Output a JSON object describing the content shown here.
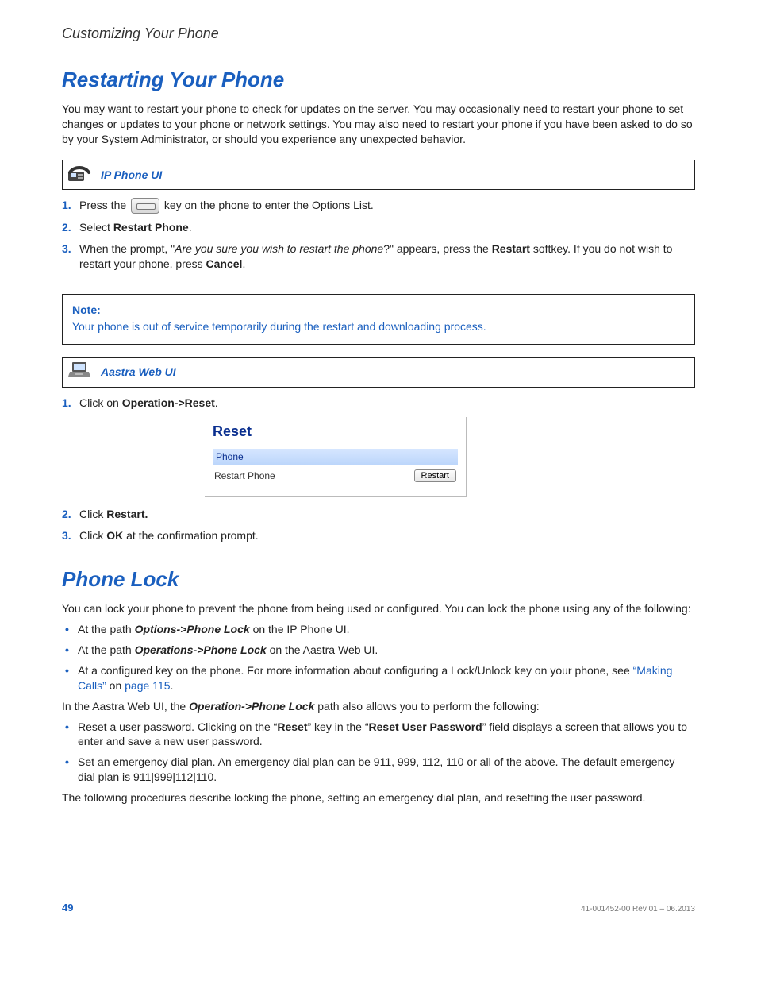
{
  "runningHead": "Customizing Your Phone",
  "sections": {
    "restart": {
      "title": "Restarting Your Phone",
      "intro": "You may want to restart your phone to check for updates on the server. You may occasionally need to restart your phone to set changes or updates to your phone or network settings.   You may also need to restart your phone if you have been asked to do so by your System Administrator, or should you experience any unexpected behavior."
    },
    "lock": {
      "title": "Phone Lock",
      "intro": "You can lock your phone to prevent the phone from being used or configured. You can lock the phone using any of the following:",
      "mid": "path also allows you to perform the following:",
      "midPathLabel": "Operation->Phone Lock",
      "midPrefix": "In the Aastra Web UI, the ",
      "closing": "The following procedures describe locking the phone, setting an emergency dial plan, and resetting the user password."
    }
  },
  "callouts": {
    "ipPhone": "IP Phone UI",
    "webUi": "Aastra Web UI"
  },
  "ipSteps": {
    "s1a": "Press the ",
    "s1b": " key on the phone to enter the Options List.",
    "s2a": "Select ",
    "s2b": "Restart Phone",
    "s2c": ".",
    "s3a": "When the prompt, \"",
    "s3b": "Are you sure you wish to restart the phone",
    "s3c": "?\" appears, press the ",
    "s3d": "Restart",
    "s3e": " softkey. If you do not wish to restart your phone, press ",
    "s3f": "Cancel",
    "s3g": "."
  },
  "note": {
    "title": "Note:",
    "body": "Your phone is out of service temporarily during the restart and downloading process."
  },
  "webSteps": {
    "s1a": "Click on ",
    "s1b": "Operation->Reset",
    "s1c": ".",
    "s2a": "Click ",
    "s2b": "Restart.",
    "s3a": "Click ",
    "s3b": "OK",
    "s3c": " at the confirmation prompt."
  },
  "screenshot": {
    "title": "Reset",
    "section": "Phone",
    "rowLabel": "Restart Phone",
    "button": "Restart"
  },
  "lockBullets": {
    "b1a": "At the path ",
    "b1b": "Options->Phone Lock",
    "b1c": " on the IP Phone UI.",
    "b2a": "At the path ",
    "b2b": "Operations->Phone Lock",
    "b2c": " on the Aastra Web UI.",
    "b3a": "At a configured key on the phone. For more information about configuring a Lock/Unlock key on your phone, see ",
    "b3link1": "“Making Calls”",
    "b3mid": " on ",
    "b3link2": "page 115",
    "b3end": "."
  },
  "lockBullets2": {
    "b1a": "Reset a user password. Clicking on the “",
    "b1b": "Reset",
    "b1c": "” key in the “",
    "b1d": "Reset User Password",
    "b1e": "” field displays a screen that allows you to enter and save a new user password.",
    "b2": "Set an emergency dial plan. An emergency dial plan can be 911, 999, 112, 110 or all of the above. The default emergency dial plan is 911|999|112|110."
  },
  "footer": {
    "page": "49",
    "rev": "41-001452-00 Rev 01 – 06.2013"
  }
}
